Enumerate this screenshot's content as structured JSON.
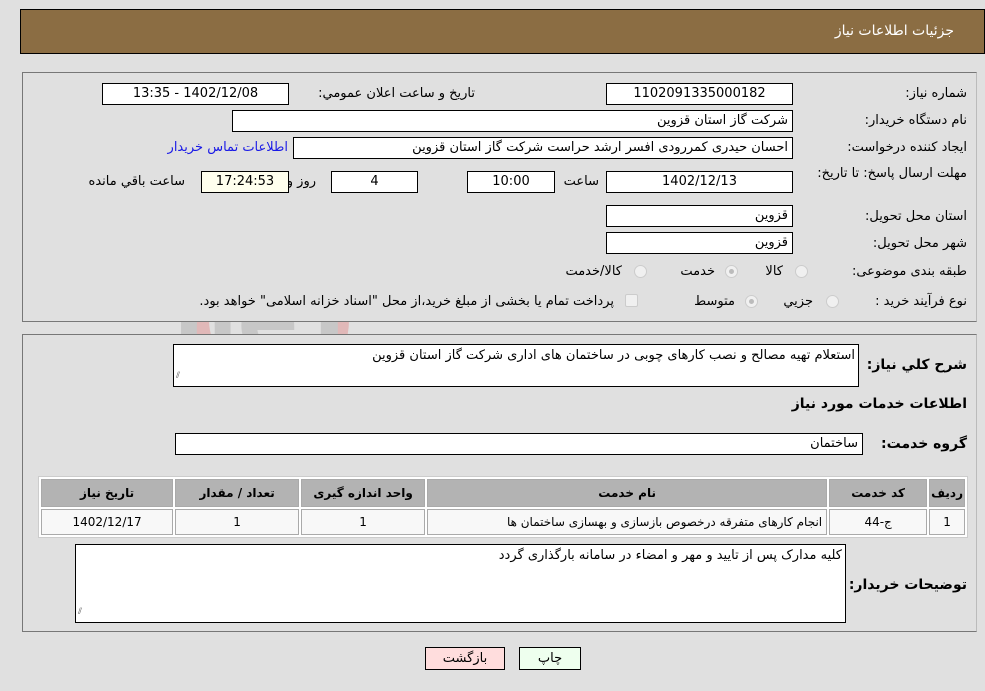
{
  "header": {
    "title": "جزئیات اطلاعات نیاز"
  },
  "details": {
    "need_number_label": "شماره نیاز:",
    "need_number": "1102091335000182",
    "announce_label": "تاریخ و ساعت اعلان عمومي:",
    "announce_value": "1402/12/08 - 13:35",
    "buyer_org_label": "نام دستگاه خريدار:",
    "buyer_org": "شرکت گاز استان قزوين",
    "requester_label": "ايجاد کننده درخواست:",
    "requester": "احسان حیدری کمررودی افسر ارشد حراست شرکت گاز استان قزوين",
    "contact_link": "اطلاعات تماس خريدار",
    "deadline_label": "مهلت ارسال پاسخ: تا تاریخ:",
    "deadline_date": "1402/12/13",
    "time_label": "ساعت",
    "deadline_time": "10:00",
    "days_value": "4",
    "days_label": "روز و",
    "remaining_time": "17:24:53",
    "remaining_label": "ساعت باقي مانده",
    "province_label": "استان محل تحویل:",
    "province": "قزوين",
    "city_label": "شهر محل تحویل:",
    "city": "قزوين",
    "category_label": "طبقه بندی موضوعی:",
    "category_options": [
      "کالا",
      "خدمت",
      "کالا/خدمت"
    ],
    "category_selected": "خدمت",
    "process_label": "نوع فرآیند خرید :",
    "process_options": [
      "جزيي",
      "متوسط"
    ],
    "process_selected": "متوسط",
    "treasury_note": "پرداخت تمام يا بخشی از مبلغ خريد،از محل \"اسناد خزانه اسلامی\" خواهد بود."
  },
  "services": {
    "general_desc_label": "شرح کلي نياز:",
    "general_desc": "استعلام تهیه مصالح و نصب کارهای چوبی در ساختمان های اداری شرکت گاز استان قزوین",
    "section_title": "اطلاعات خدمات مورد نیاز",
    "group_label": "گروه خدمت:",
    "group_value": "ساختمان",
    "table": {
      "headers": [
        "رديف",
        "کد خدمت",
        "نام خدمت",
        "واحد اندازه گيری",
        "تعداد / مقدار",
        "تاريخ نياز"
      ],
      "rows": [
        [
          "1",
          "ج-44",
          "انجام کارهای متفرقه درخصوص بازسازی و بهسازی ساختمان ها",
          "1",
          "1",
          "1402/12/17"
        ]
      ]
    },
    "buyer_notes_label": "توضيحات خريدار:",
    "buyer_notes": "کلیه مدارک پس از تایید و مهر و امضاء در سامانه بارگذاری گردد"
  },
  "buttons": {
    "print": "چاپ",
    "back": "بازگشت"
  },
  "colors": {
    "header_bg": "#8b6d43",
    "print_bg": "#eeffee",
    "back_bg": "#ffdddd",
    "link": "#1a1ae6"
  }
}
